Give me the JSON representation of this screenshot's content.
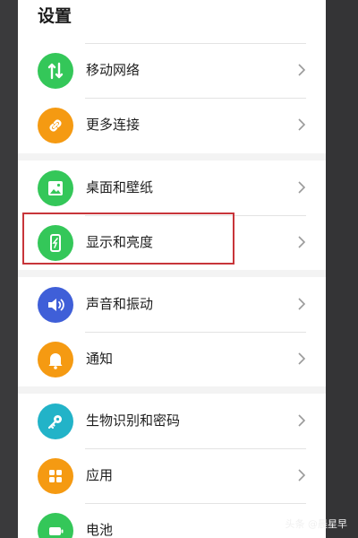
{
  "header": {
    "title": "设置"
  },
  "groups": [
    {
      "items": [
        {
          "label": "移动网络",
          "icon": "mobile-network-icon",
          "color": "#34c759"
        },
        {
          "label": "更多连接",
          "icon": "link-icon",
          "color": "#f59a12"
        }
      ]
    },
    {
      "items": [
        {
          "label": "桌面和壁纸",
          "icon": "wallpaper-icon",
          "color": "#34c759"
        },
        {
          "label": "显示和亮度",
          "icon": "display-brightness-icon",
          "color": "#34c759",
          "highlighted": true
        }
      ]
    },
    {
      "items": [
        {
          "label": "声音和振动",
          "icon": "sound-icon",
          "color": "#3f5fd8"
        },
        {
          "label": "通知",
          "icon": "bell-icon",
          "color": "#f59a12"
        }
      ]
    },
    {
      "items": [
        {
          "label": "生物识别和密码",
          "icon": "key-icon",
          "color": "#22b3c8"
        },
        {
          "label": "应用",
          "icon": "apps-icon",
          "color": "#f59a12"
        },
        {
          "label": "电池",
          "icon": "battery-icon",
          "color": "#34c759"
        }
      ]
    }
  ],
  "watermark": {
    "text": "头条 @晨星早"
  },
  "colors": {
    "highlight_border": "#c8353a",
    "panel_bg": "#f3f3f3"
  }
}
